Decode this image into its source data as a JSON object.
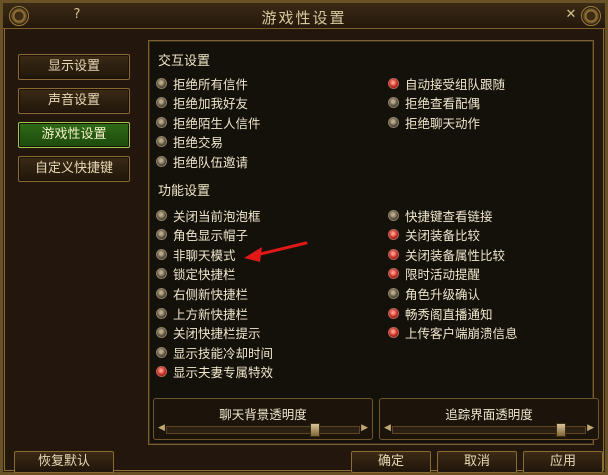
{
  "window": {
    "title": "游戏性设置"
  },
  "titlebar": {
    "help_label": "?",
    "close_label": "✕"
  },
  "sidebar": {
    "items": [
      {
        "label": "显示设置"
      },
      {
        "label": "声音设置"
      },
      {
        "label": "游戏性设置",
        "active": true
      },
      {
        "label": "自定义快捷键"
      }
    ]
  },
  "interaction": {
    "title": "交互设置",
    "left": [
      {
        "label": "拒绝所有信件",
        "checked": false
      },
      {
        "label": "拒绝加我好友",
        "checked": false
      },
      {
        "label": "拒绝陌生人信件",
        "checked": false
      },
      {
        "label": "拒绝交易",
        "checked": false
      },
      {
        "label": "拒绝队伍邀请",
        "checked": false
      }
    ],
    "right": [
      {
        "label": "自动接受组队跟随",
        "checked": true
      },
      {
        "label": "拒绝查看配偶",
        "checked": false
      },
      {
        "label": "拒绝聊天动作",
        "checked": false
      }
    ]
  },
  "function": {
    "title": "功能设置",
    "left": [
      {
        "label": "关闭当前泡泡框",
        "checked": false
      },
      {
        "label": "角色显示帽子",
        "checked": false
      },
      {
        "label": "非聊天模式",
        "checked": false
      },
      {
        "label": "锁定快捷栏",
        "checked": false
      },
      {
        "label": "右侧新快捷栏",
        "checked": false
      },
      {
        "label": "上方新快捷栏",
        "checked": false
      },
      {
        "label": "关闭快捷栏提示",
        "checked": false
      },
      {
        "label": "显示技能冷却时间",
        "checked": false
      },
      {
        "label": "显示夫妻专属特效",
        "checked": true
      }
    ],
    "right": [
      {
        "label": "快捷键查看链接",
        "checked": false
      },
      {
        "label": "关闭装备比较",
        "checked": true
      },
      {
        "label": "关闭装备属性比较",
        "checked": true
      },
      {
        "label": "限时活动提醒",
        "checked": true
      },
      {
        "label": "角色升级确认",
        "checked": false
      },
      {
        "label": "畅秀阁直播通知",
        "checked": true
      },
      {
        "label": "上传客户端崩溃信息",
        "checked": true
      }
    ]
  },
  "sliders": [
    {
      "label": "聊天背景透明度",
      "level": 0.76
    },
    {
      "label": "追踪界面透明度",
      "level": 0.86
    }
  ],
  "footer": {
    "reset_label": "恢复默认",
    "ok_label": "确定",
    "cancel_label": "取消",
    "apply_label": "应用"
  },
  "colors": {
    "accent_gold": "#8a6b34",
    "active_tab_green": "#2f6a17",
    "radio_on_red": "#c42a1f",
    "annotation_arrow_red": "#e01818"
  },
  "icons": [
    "gear-icon",
    "help-icon",
    "close-icon",
    "radio-icon",
    "annotation-arrow"
  ]
}
